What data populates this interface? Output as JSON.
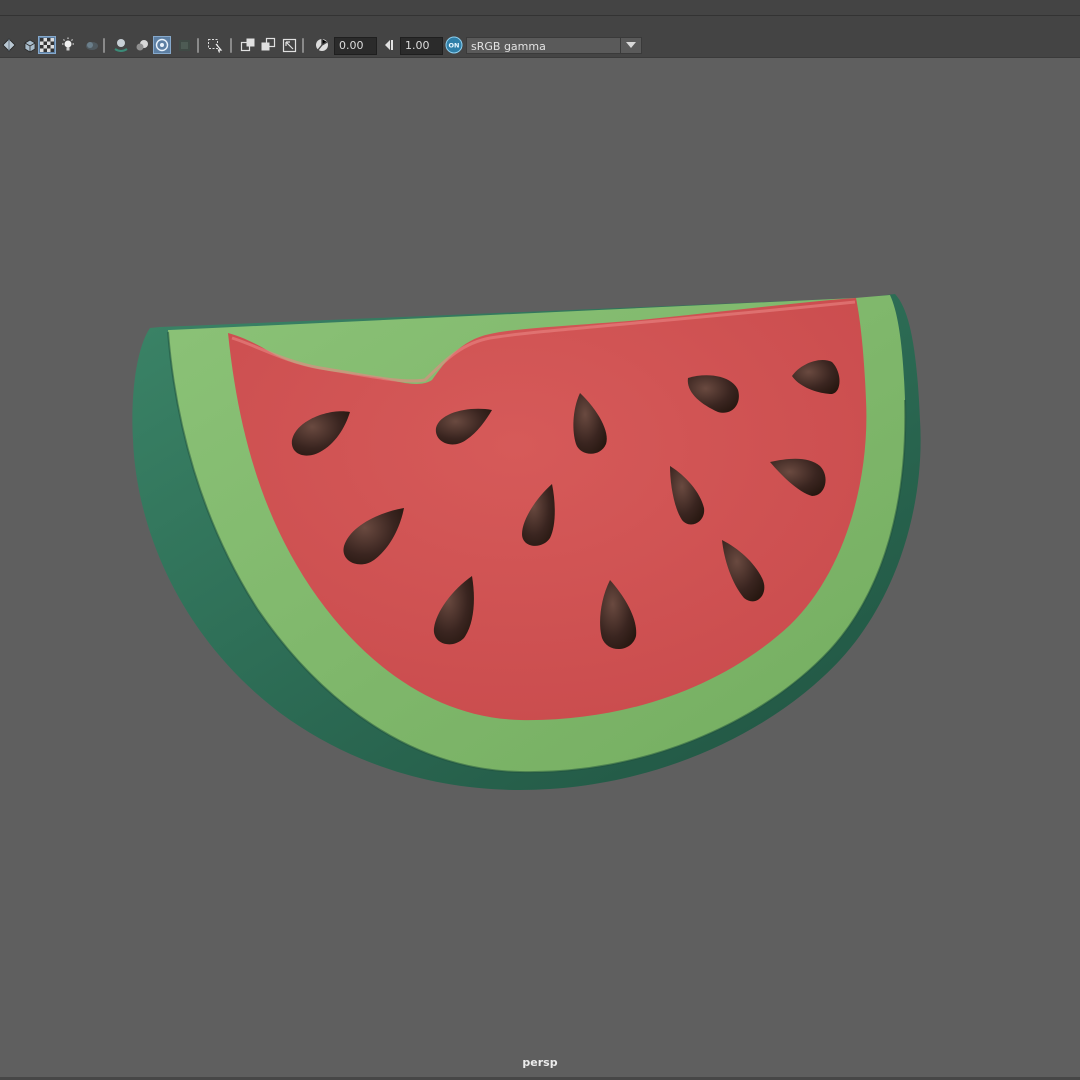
{
  "toolbar": {
    "exposure_value": "0.00",
    "gamma_value": "1.00",
    "colorspace_label": "sRGB gamma",
    "colorspace_toggle_label": "ON",
    "icons": [
      "shading-icon",
      "wireframe-cube-icon",
      "checker-texture-icon",
      "light-bulb-icon",
      "shadow-icon",
      "ambient-occlusion-icon",
      "motion-blur-icon",
      "antialiasing-icon",
      "isolate-select-icon",
      "xray-icon",
      "xray-joints-icon",
      "xray-components-icon",
      "camera-attributes-icon",
      "film-gate-icon",
      "resolution-gate-icon",
      "exposure-icon",
      "gamma-icon",
      "colorspace-toggle-icon"
    ]
  },
  "viewport": {
    "camera_name": "persp",
    "background_color": "#5f5f5f"
  },
  "scene": {
    "object": "watermelon slice",
    "colors": {
      "flesh": "#cf5353",
      "inner_rind": "#7fb86b",
      "outer_rind": "#2e6f57",
      "seed": "#3a2520"
    }
  }
}
